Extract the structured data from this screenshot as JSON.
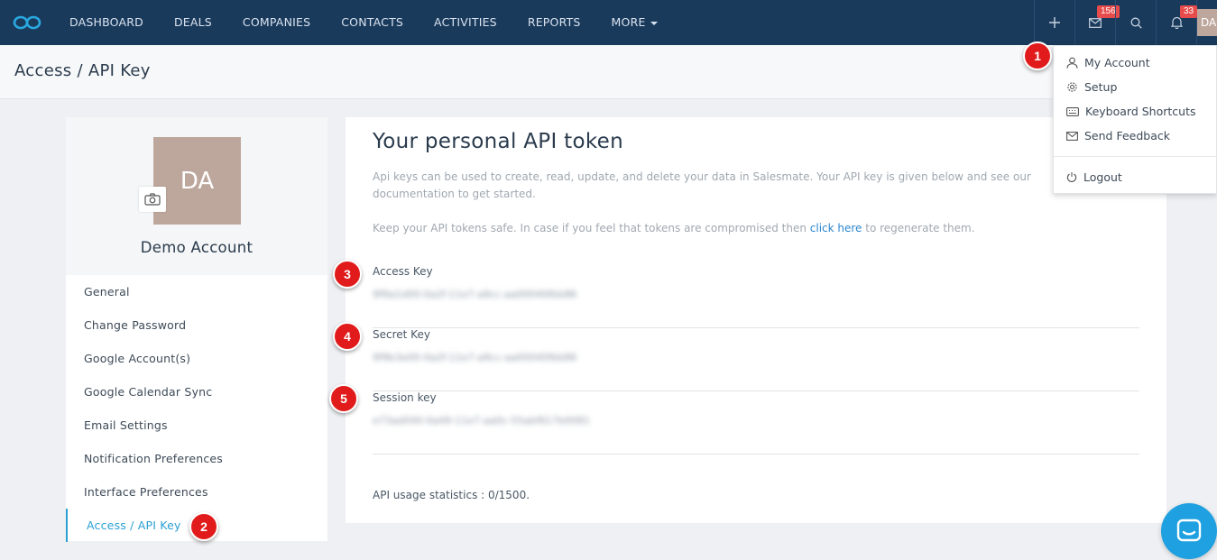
{
  "nav": {
    "items": [
      {
        "label": "DASHBOARD"
      },
      {
        "label": "DEALS"
      },
      {
        "label": "COMPANIES"
      },
      {
        "label": "CONTACTS"
      },
      {
        "label": "ACTIVITIES"
      },
      {
        "label": "REPORTS"
      },
      {
        "label": "MORE"
      }
    ],
    "mail_badge": "156",
    "notification_badge": "33",
    "avatar_initials": "DA",
    "icons": [
      "plus-icon",
      "mail-icon",
      "search-icon",
      "bell-icon"
    ]
  },
  "header": {
    "title": "Access / API Key"
  },
  "profile": {
    "initials": "DA",
    "name": "Demo Account",
    "menu": [
      {
        "label": "General"
      },
      {
        "label": "Change Password"
      },
      {
        "label": "Google Account(s)"
      },
      {
        "label": "Google Calendar Sync"
      },
      {
        "label": "Email Settings"
      },
      {
        "label": "Notification Preferences"
      },
      {
        "label": "Interface Preferences"
      },
      {
        "label": "Access / API Key"
      }
    ]
  },
  "main": {
    "title": "Your personal API token",
    "description": "Api keys can be used to create, read, update, and delete your data in Salesmate. Your API key is given below and see our documentation to get started.",
    "safety_before": "Keep your API tokens safe. In case if you feel that tokens are compromised then ",
    "safety_link": "click here",
    "safety_after": " to regenerate them.",
    "keys": [
      {
        "label": "Access Key",
        "value": "9f9a1d00-0a2f-11e7-a9cc-aa00040fbb86"
      },
      {
        "label": "Secret Key",
        "value": "9f9b3e00-0a2f-11e7-a9cc-aa00040fbb86"
      },
      {
        "label": "Session key",
        "value": "e73ad040-0a49-11e7-aa0c-55abf617b0081"
      }
    ],
    "usage": "API usage statistics : 0/1500."
  },
  "dropdown": {
    "items": [
      {
        "label": "My Account",
        "icon": "user-icon"
      },
      {
        "label": "Setup",
        "icon": "gear-icon"
      },
      {
        "label": "Keyboard Shortcuts",
        "icon": "keyboard-icon"
      },
      {
        "label": "Send Feedback",
        "icon": "envelope-icon"
      },
      {
        "label": "Logout",
        "icon": "power-icon"
      }
    ]
  },
  "steps": [
    "1",
    "2",
    "3",
    "4",
    "5"
  ],
  "colors": {
    "nav_bg": "#1a3a5c",
    "accent": "#2aa0d4",
    "step_badge": "#e11b1b",
    "chat": "#1fa0e0"
  }
}
